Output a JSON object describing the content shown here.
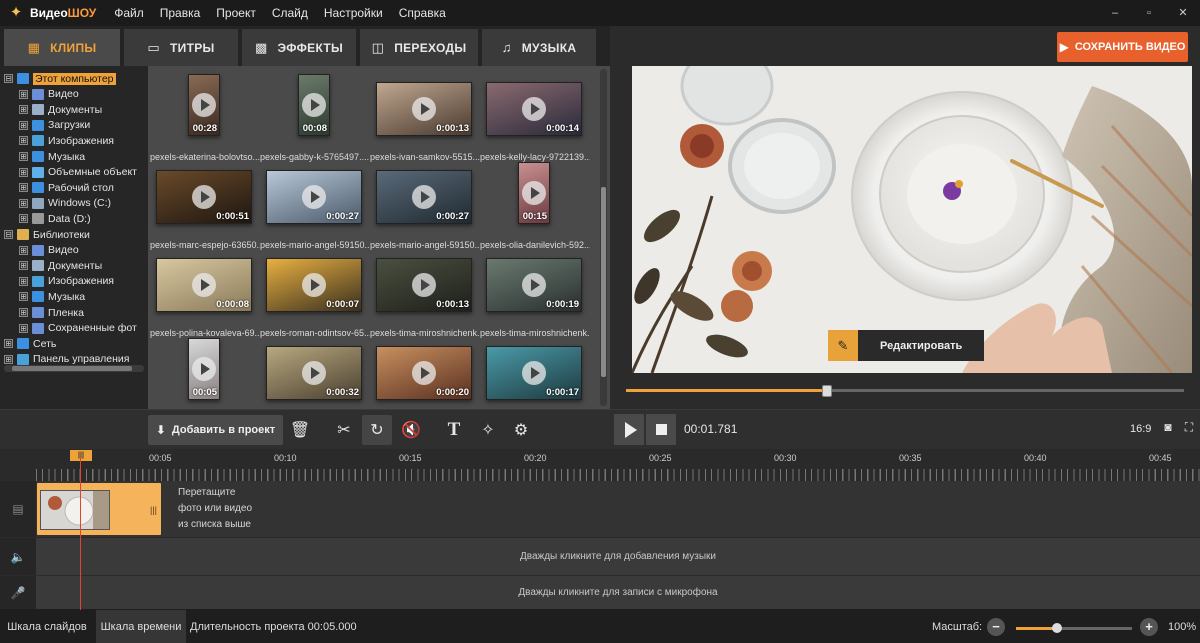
{
  "app": {
    "title_main": "Видео",
    "title_accent": "ШОУ",
    "menu": [
      "Файл",
      "Правка",
      "Проект",
      "Слайд",
      "Настройки",
      "Справка"
    ],
    "window_controls": [
      "‒",
      "▫",
      "✕"
    ]
  },
  "tabs": [
    {
      "label": "КЛИПЫ",
      "icon": "film-icon",
      "active": true
    },
    {
      "label": "ТИТРЫ",
      "icon": "titles-icon",
      "active": false
    },
    {
      "label": "ЭФФЕКТЫ",
      "icon": "effects-icon",
      "active": false
    },
    {
      "label": "ПЕРЕХОДЫ",
      "icon": "transitions-icon",
      "active": false
    },
    {
      "label": "МУЗЫКА",
      "icon": "music-note-icon",
      "active": false
    }
  ],
  "save_button": "СОХРАНИТЬ ВИДЕО",
  "tree": [
    {
      "label": "Этот компьютер",
      "level": 0,
      "expander": "⊟",
      "icon": "computer-icon",
      "color": "#3d8fe0",
      "selected": true
    },
    {
      "label": "Видео",
      "level": 1,
      "expander": "⊞",
      "icon": "video-folder-icon",
      "color": "#6b8fd6"
    },
    {
      "label": "Документы",
      "level": 1,
      "expander": "⊞",
      "icon": "documents-icon",
      "color": "#9ab0c8"
    },
    {
      "label": "Загрузки",
      "level": 1,
      "expander": "⊞",
      "icon": "download-icon",
      "color": "#3d8fe0"
    },
    {
      "label": "Изображения",
      "level": 1,
      "expander": "⊞",
      "icon": "images-icon",
      "color": "#4aa0d8"
    },
    {
      "label": "Музыка",
      "level": 1,
      "expander": "⊞",
      "icon": "music-icon",
      "color": "#3d8fe0"
    },
    {
      "label": "Объемные объект",
      "level": 1,
      "expander": "⊞",
      "icon": "3d-objects-icon",
      "color": "#5fb0e8"
    },
    {
      "label": "Рабочий стол",
      "level": 1,
      "expander": "⊞",
      "icon": "desktop-icon",
      "color": "#3d8fe0"
    },
    {
      "label": "Windows (C:)",
      "level": 1,
      "expander": "⊞",
      "icon": "drive-icon",
      "color": "#8fa8c0"
    },
    {
      "label": "Data (D:)",
      "level": 1,
      "expander": "⊞",
      "icon": "drive-icon",
      "color": "#999"
    },
    {
      "label": "Библиотеки",
      "level": 0,
      "expander": "⊟",
      "icon": "library-icon",
      "color": "#e0b050"
    },
    {
      "label": "Видео",
      "level": 1,
      "expander": "⊞",
      "icon": "video-folder-icon",
      "color": "#6b8fd6"
    },
    {
      "label": "Документы",
      "level": 1,
      "expander": "⊞",
      "icon": "documents-icon",
      "color": "#9ab0c8"
    },
    {
      "label": "Изображения",
      "level": 1,
      "expander": "⊞",
      "icon": "images-icon",
      "color": "#4aa0d8"
    },
    {
      "label": "Музыка",
      "level": 1,
      "expander": "⊞",
      "icon": "music-icon",
      "color": "#3d8fe0"
    },
    {
      "label": "Пленка",
      "level": 1,
      "expander": "⊞",
      "icon": "camera-roll-icon",
      "color": "#6b8fd6"
    },
    {
      "label": "Сохраненные фот",
      "level": 1,
      "expander": "⊞",
      "icon": "saved-pictures-icon",
      "color": "#6b8fd6"
    },
    {
      "label": "Сеть",
      "level": 0,
      "expander": "⊞",
      "icon": "network-icon",
      "color": "#3d8fe0"
    },
    {
      "label": "Панель управления",
      "level": 0,
      "expander": "⊞",
      "icon": "control-panel-icon",
      "color": "#4aa0d8"
    }
  ],
  "clips": [
    {
      "name": "pexels-ekaterina-bolovtso...",
      "duration": "00:28",
      "orientation": "portrait",
      "colors": [
        "#8a6a55",
        "#3a2a22"
      ]
    },
    {
      "name": "pexels-gabby-k-5765497....",
      "duration": "00:08",
      "orientation": "portrait",
      "colors": [
        "#6a7a6a",
        "#2e3a30"
      ]
    },
    {
      "name": "pexels-ivan-samkov-5515...",
      "duration": "0:00:13",
      "orientation": "landscape",
      "colors": [
        "#c0a890",
        "#4a3a30"
      ]
    },
    {
      "name": "pexels-kelly-lacy-9722139...",
      "duration": "0:00:14",
      "orientation": "landscape",
      "colors": [
        "#8a6a70",
        "#2a2a3a"
      ]
    },
    {
      "name": "pexels-marc-espejo-63650...",
      "duration": "0:00:51",
      "orientation": "landscape",
      "colors": [
        "#6a4a2a",
        "#1e1610"
      ]
    },
    {
      "name": "pexels-mario-angel-59150...",
      "duration": "0:00:27",
      "orientation": "landscape",
      "colors": [
        "#b8c8d8",
        "#4a5a6a"
      ]
    },
    {
      "name": "pexels-mario-angel-59150...",
      "duration": "0:00:27",
      "orientation": "landscape",
      "colors": [
        "#5a6a7a",
        "#202a30"
      ]
    },
    {
      "name": "pexels-olia-danilevich-592...",
      "duration": "00:15",
      "orientation": "portrait",
      "colors": [
        "#c89090",
        "#6a3a40"
      ]
    },
    {
      "name": "pexels-polina-kovaleva-69...",
      "duration": "0:00:08",
      "orientation": "landscape",
      "colors": [
        "#d8c8a0",
        "#8a7a5a"
      ]
    },
    {
      "name": "pexels-roman-odintsov-65...",
      "duration": "0:00:07",
      "orientation": "landscape",
      "colors": [
        "#e8b040",
        "#3a3020"
      ]
    },
    {
      "name": "pexels-tima-miroshnichenk...",
      "duration": "0:00:13",
      "orientation": "landscape",
      "colors": [
        "#4a5040",
        "#1e201a"
      ]
    },
    {
      "name": "pexels-tima-miroshnichenk...",
      "duration": "0:00:19",
      "orientation": "landscape",
      "colors": [
        "#6a7a70",
        "#2a3030"
      ]
    },
    {
      "name": "",
      "duration": "00:05",
      "orientation": "portrait",
      "colors": [
        "#d8d8d8",
        "#8a8080"
      ]
    },
    {
      "name": "",
      "duration": "0:00:32",
      "orientation": "landscape",
      "colors": [
        "#b8a880",
        "#4a4030"
      ]
    },
    {
      "name": "",
      "duration": "0:00:20",
      "orientation": "landscape",
      "colors": [
        "#c89060",
        "#5a3020"
      ]
    },
    {
      "name": "",
      "duration": "0:00:17",
      "orientation": "landscape",
      "colors": [
        "#4a9aa8",
        "#1e3a40"
      ]
    }
  ],
  "preview": {
    "edit_label": "Редактировать",
    "seek_progress": 0.36
  },
  "toolbar": {
    "add_label": "Добавить в проект",
    "tools": [
      "trash-icon",
      "scissors-icon",
      "rotate-icon",
      "mute-icon",
      "text-icon",
      "magic-wand-icon",
      "gear-icon"
    ],
    "timecode": "00:01.781",
    "ratio": "16:9"
  },
  "timeline": {
    "ruler": [
      "00:05",
      "00:10",
      "00:15",
      "00:20",
      "00:25",
      "00:30",
      "00:35",
      "00:40",
      "00:45"
    ],
    "drop_hint": [
      "Перетащите",
      "фото или видео",
      "из списка выше"
    ],
    "music_hint": "Дважды кликните для добавления музыки",
    "mic_hint": "Дважды кликните для записи с микрофона"
  },
  "status": {
    "slides_tab": "Шкала слайдов",
    "timeline_tab": "Шкала времени",
    "duration": "Длительность проекта 00:05.000",
    "scale_label": "Масштаб:",
    "zoom_value": "100%",
    "zoom_level": 0.35
  }
}
